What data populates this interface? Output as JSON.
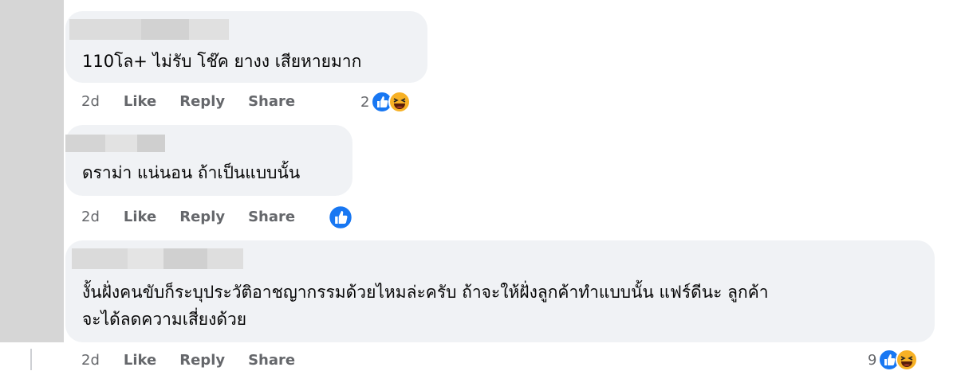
{
  "comments": [
    {
      "text": "110โล+ ไม่รับ โช๊ค ยางง เสียหายมาก",
      "timestamp": "2d",
      "like_label": "Like",
      "reply_label": "Reply",
      "share_label": "Share",
      "reaction_count": "2",
      "reactions": [
        "like-icon",
        "haha-icon"
      ]
    },
    {
      "text": "ดราม่า แน่นอน ถ้าเป็นแบบนั้น",
      "timestamp": "2d",
      "like_label": "Like",
      "reply_label": "Reply",
      "share_label": "Share",
      "reaction_count": "",
      "reactions": [
        "like-icon"
      ]
    },
    {
      "text_line1": "งั้นฝั่งคนขับก็ระบุประวัติอาชญากรรมด้วยไหมล่ะครับ ถ้าจะให้ฝั่งลูกค้าทำแบบนั้น แฟร์ดีนะ ลูกค้า",
      "text_line2": "จะได้ลดความเสี่ยงด้วย",
      "timestamp": "2d",
      "like_label": "Like",
      "reply_label": "Reply",
      "share_label": "Share",
      "reaction_count": "9",
      "reactions": [
        "like-icon",
        "haha-icon"
      ]
    }
  ],
  "colors": {
    "bubble": "#f0f2f5",
    "meta_text": "#65676b",
    "like_blue": "#1877f2",
    "haha_orange": "#f7b125"
  }
}
